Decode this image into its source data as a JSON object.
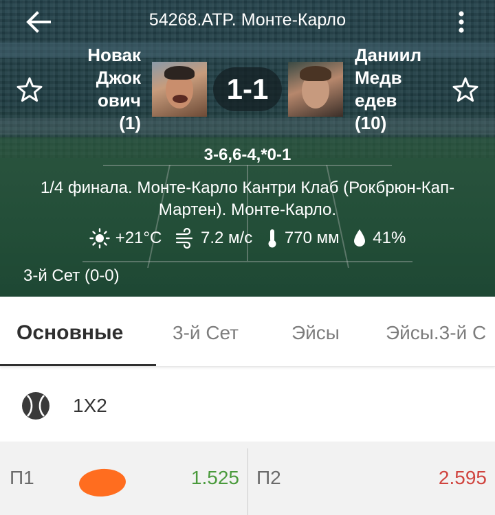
{
  "header": {
    "title": "54268.ATP. Монте-Карло",
    "player1": {
      "name": "Новак Джок ович",
      "rank": "(1)"
    },
    "player2": {
      "name": "Даниил Медв едев",
      "rank": "(10)"
    },
    "score": "1-1",
    "sets": "3-6,6-4,*0-1",
    "tournament": "1/4 финала. Монте-Карло Кантри Клаб (Рокбрюн-Кап-Мартен). Монте-Карло.",
    "weather": {
      "temperature": "+21°C",
      "wind": "7.2 м/с",
      "pressure": "770 мм",
      "humidity": "41%"
    },
    "current_set": "3-й  Сет (0-0)"
  },
  "icons": {
    "back": "arrow-left-icon",
    "more": "more-vertical-icon",
    "favorite": "star-outline-icon",
    "sun": "sun-icon",
    "wind": "wind-icon",
    "thermometer": "thermometer-icon",
    "drop": "drop-icon",
    "ball": "tennis-ball-icon"
  },
  "tabs": [
    {
      "label": "Основные"
    },
    {
      "label": "3-й  Сет"
    },
    {
      "label": "Эйсы"
    },
    {
      "label": "Эйсы.3-й  С"
    }
  ],
  "market": {
    "title": "1X2",
    "odds": [
      {
        "label": "П1",
        "value": "1.525",
        "color": "#4a9a3c"
      },
      {
        "label": "П2",
        "value": "2.595",
        "color": "#d0443f"
      }
    ]
  },
  "colors": {
    "odds_up": "#4a9a3c",
    "odds_down": "#d0443f",
    "scribble": "#ff6d1f"
  }
}
